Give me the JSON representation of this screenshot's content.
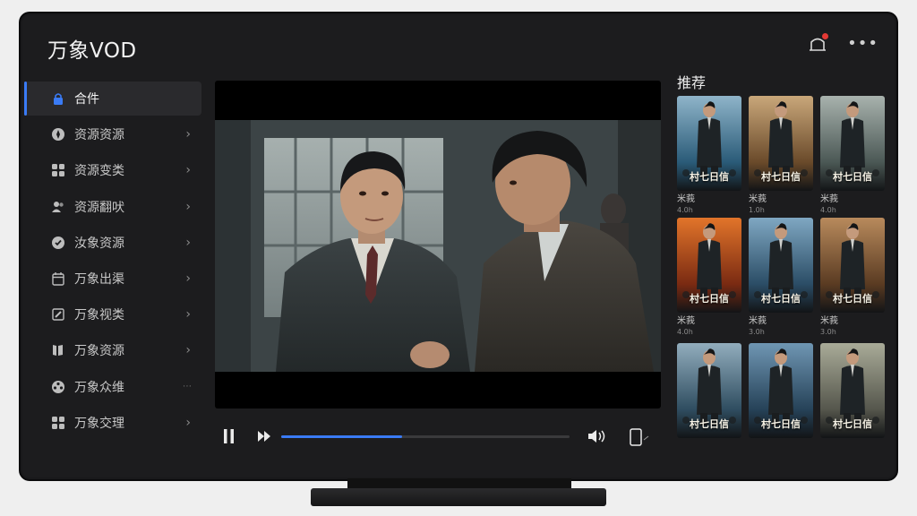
{
  "app": {
    "title": "万象VOD"
  },
  "sidebar": {
    "items": [
      {
        "label": "合件",
        "icon": "lock-icon",
        "active": true,
        "trail": ""
      },
      {
        "label": "资源资源",
        "icon": "compass-icon",
        "active": false,
        "trail": "›"
      },
      {
        "label": "资源变类",
        "icon": "grid-icon",
        "active": false,
        "trail": "›"
      },
      {
        "label": "资源翻吠",
        "icon": "users-icon",
        "active": false,
        "trail": "›"
      },
      {
        "label": "汝象资源",
        "icon": "check-shield-icon",
        "active": false,
        "trail": "›"
      },
      {
        "label": "万象出渠",
        "icon": "calendar-icon",
        "active": false,
        "trail": "›"
      },
      {
        "label": "万象视类",
        "icon": "edit-icon",
        "active": false,
        "trail": "›"
      },
      {
        "label": "万象资源",
        "icon": "book-icon",
        "active": false,
        "trail": "›"
      },
      {
        "label": "万象众维",
        "icon": "film-reel-icon",
        "active": false,
        "trail": "⋯"
      },
      {
        "label": "万象交理",
        "icon": "apps-icon",
        "active": false,
        "trail": "›"
      }
    ]
  },
  "player": {
    "progress": 0.42
  },
  "recommend": {
    "title": "推荐",
    "posters": [
      {
        "title": "村七日信",
        "label": "米莪",
        "sub": "4.0h"
      },
      {
        "title": "村七日信",
        "label": "米莪",
        "sub": "1.0h"
      },
      {
        "title": "村七日信",
        "label": "米莪",
        "sub": "4.0h"
      },
      {
        "title": "村七日信",
        "label": "米莪",
        "sub": "4.0h"
      },
      {
        "title": "村七日信",
        "label": "米莪",
        "sub": "3.0h"
      },
      {
        "title": "村七日信",
        "label": "米莪",
        "sub": "3.0h"
      },
      {
        "title": "村七日信",
        "label": "",
        "sub": ""
      },
      {
        "title": "村七日信",
        "label": "",
        "sub": ""
      },
      {
        "title": "村七日信",
        "label": "",
        "sub": ""
      }
    ]
  },
  "colors": {
    "accent": "#3a7bf5",
    "background": "#1c1c1e",
    "notification": "#e53935"
  }
}
